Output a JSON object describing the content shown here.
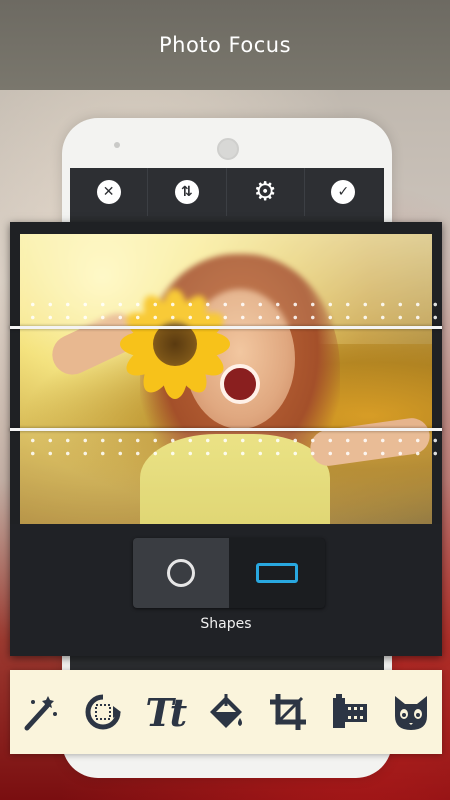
{
  "header": {
    "title": "Photo Focus"
  },
  "phone_toolbar": {
    "buttons": [
      {
        "icon": "close-icon",
        "glyph": "✕"
      },
      {
        "icon": "flip-icon",
        "glyph": "⇅"
      },
      {
        "icon": "gear-icon",
        "glyph": "⚙"
      },
      {
        "icon": "check-icon",
        "glyph": "✓"
      }
    ]
  },
  "shapes_panel": {
    "label": "Shapes",
    "options": [
      {
        "icon": "circle-shape-icon",
        "selected": false
      },
      {
        "icon": "rectangle-shape-icon",
        "selected": true
      }
    ],
    "selected_color": "#29a8e0"
  },
  "tools": [
    {
      "icon": "magic-wand-icon"
    },
    {
      "icon": "rotate-crop-icon"
    },
    {
      "icon": "text-icon",
      "glyph": "Tt"
    },
    {
      "icon": "paint-bucket-icon"
    },
    {
      "icon": "crop-icon"
    },
    {
      "icon": "film-icon"
    },
    {
      "icon": "cat-sticker-icon"
    }
  ],
  "colors": {
    "header_bg": "#6d6a62",
    "tools_bg": "#faf4dc",
    "icon_dark": "#2c3544"
  }
}
